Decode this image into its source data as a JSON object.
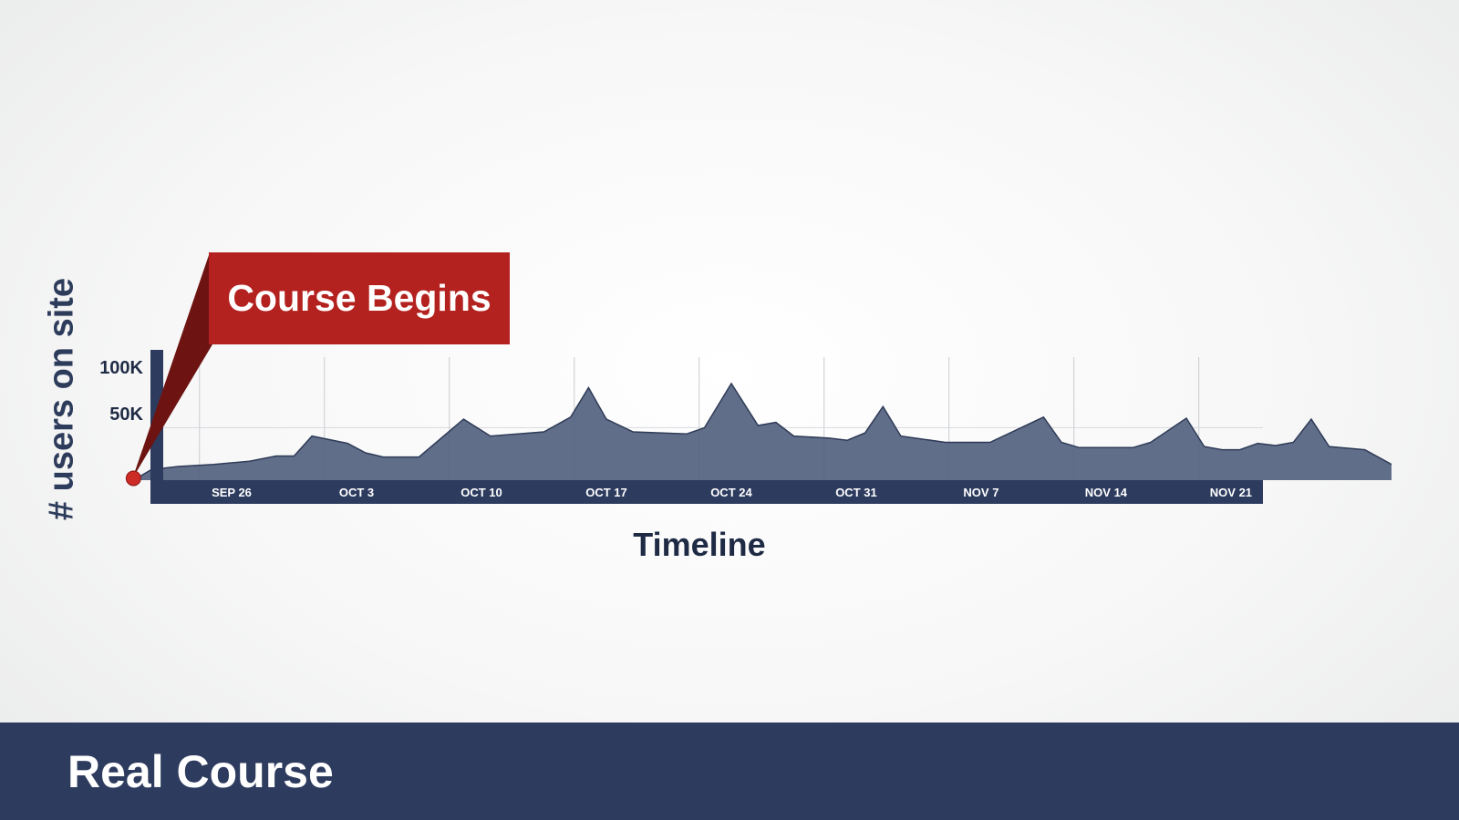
{
  "footer": {
    "title": "Real Course"
  },
  "colors": {
    "area_fill": "#53627f",
    "area_stroke": "#2f3b57",
    "axis": "#2d3b5e",
    "callout": "#b3221f",
    "footer_bg": "#2d3b5e"
  },
  "chart_data": {
    "type": "area",
    "xlabel": "Timeline",
    "ylabel": "# users on site",
    "x_ticks": [
      "SEP 26",
      "OCT 3",
      "OCT 10",
      "OCT 17",
      "OCT 24",
      "OCT 31",
      "NOV 7",
      "NOV 14",
      "NOV 21"
    ],
    "y_ticks": [
      {
        "label": "50K",
        "value": 50000
      },
      {
        "label": "100K",
        "value": 100000
      }
    ],
    "ylim": [
      0,
      100000
    ],
    "grid": true,
    "x_units": "days since SEP 26",
    "series": [
      {
        "values": [
          [
            -5.5,
            0
          ],
          [
            -4.5,
            10000
          ],
          [
            -3,
            13000
          ],
          [
            -1,
            15000
          ],
          [
            1,
            18000
          ],
          [
            2.5,
            23000
          ],
          [
            3.5,
            23000
          ],
          [
            4.5,
            42000
          ],
          [
            6.5,
            35000
          ],
          [
            7.5,
            26000
          ],
          [
            8.5,
            22000
          ],
          [
            10.5,
            22000
          ],
          [
            13,
            58000
          ],
          [
            14.5,
            42000
          ],
          [
            17.5,
            46000
          ],
          [
            19,
            60000
          ],
          [
            20,
            88000
          ],
          [
            21,
            58000
          ],
          [
            22.5,
            46000
          ],
          [
            25.5,
            44000
          ],
          [
            26.5,
            50000
          ],
          [
            28,
            92000
          ],
          [
            29.5,
            52000
          ],
          [
            30.5,
            55000
          ],
          [
            31.5,
            42000
          ],
          [
            33.5,
            40000
          ],
          [
            34.5,
            38000
          ],
          [
            35.5,
            45000
          ],
          [
            36.5,
            70000
          ],
          [
            37.5,
            42000
          ],
          [
            40,
            36000
          ],
          [
            42.5,
            36000
          ],
          [
            45.5,
            60000
          ],
          [
            46.5,
            36000
          ],
          [
            47.5,
            31000
          ],
          [
            50.5,
            31000
          ],
          [
            51.5,
            36000
          ],
          [
            53.5,
            59000
          ],
          [
            54.5,
            32000
          ],
          [
            55.5,
            29000
          ],
          [
            56.5,
            29000
          ],
          [
            57.5,
            35000
          ],
          [
            58.5,
            33000
          ],
          [
            59.5,
            36000
          ],
          [
            60.5,
            58000
          ],
          [
            61.5,
            32000
          ],
          [
            63.5,
            29000
          ],
          [
            65,
            15000
          ]
        ]
      }
    ],
    "annotation": {
      "text": "Course Begins",
      "at": -5.5,
      "value": 0
    }
  }
}
